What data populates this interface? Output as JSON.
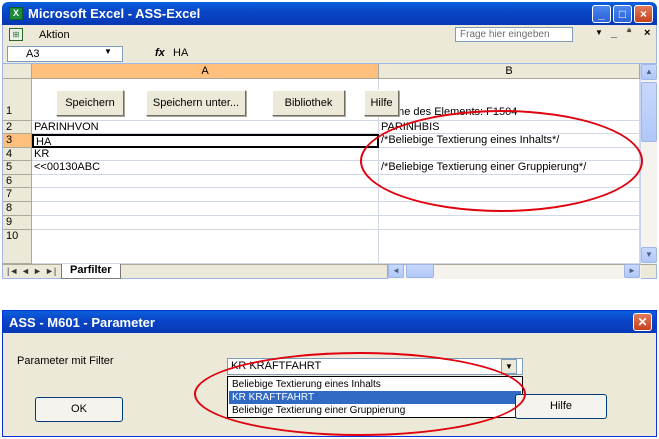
{
  "excel": {
    "title": "Microsoft Excel - ASS-Excel",
    "window_buttons": [
      "_",
      "□",
      "×"
    ],
    "menu": {
      "item": "Aktion",
      "help_placeholder": "Frage hier eingeben",
      "mdi": [
        "-",
        "_",
        "ð",
        "×"
      ]
    },
    "formula_bar": {
      "cell_ref": "A3",
      "fx": "fx",
      "value": "HA"
    },
    "columns": [
      "A",
      "B"
    ],
    "buttons": [
      "Speichern",
      "Speichern unter...",
      "Bibliothek",
      "Hilfe"
    ],
    "rows": [
      {
        "num": "1",
        "a": "",
        "b": "Name des Elements: F1504"
      },
      {
        "num": "2",
        "a": "PARINHVON",
        "b": "PARINHBIS"
      },
      {
        "num": "3",
        "a": "HA",
        "b": "/*Beliebige Textierung eines Inhalts*/"
      },
      {
        "num": "4",
        "a": "KR",
        "b": ""
      },
      {
        "num": "5",
        "a": "<<00130ABC",
        "b": "/*Beliebige Textierung einer Gruppierung*/"
      },
      {
        "num": "6",
        "a": "",
        "b": ""
      },
      {
        "num": "7",
        "a": "",
        "b": ""
      },
      {
        "num": "8",
        "a": "",
        "b": ""
      },
      {
        "num": "9",
        "a": "",
        "b": ""
      },
      {
        "num": "10",
        "a": "",
        "b": ""
      }
    ],
    "sheet_tab": "Parfilter",
    "tab_nav": [
      "|◄",
      "◄",
      "►",
      "►|"
    ]
  },
  "dialog": {
    "title": "ASS - M601 - Parameter",
    "label": "Parameter mit Filter",
    "selected_value": "KR KRAFTFAHRT",
    "options": [
      "Beliebige Textierung eines Inhalts",
      "KR KRAFTFAHRT",
      "Beliebige Textierung einer Gruppierung"
    ],
    "ok_label": "OK",
    "help_label": "Hilfe"
  },
  "colors": {
    "annotation": "#e0000e",
    "title_bar": "#0a46c8",
    "selection": "#316ac5"
  }
}
